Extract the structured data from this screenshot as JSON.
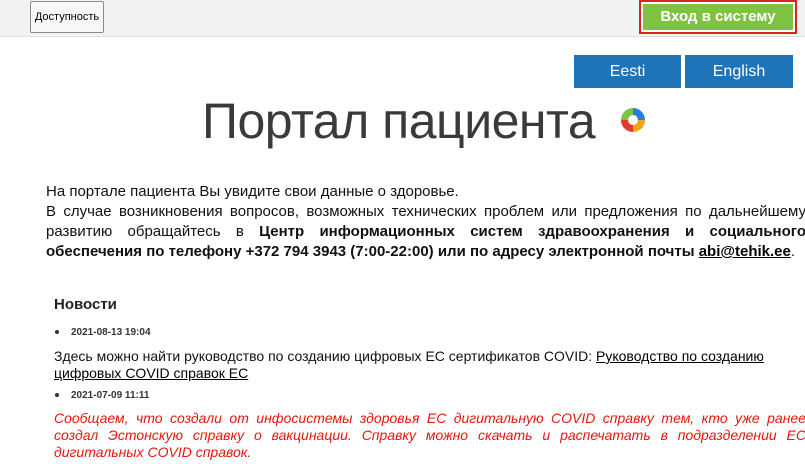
{
  "topbar": {
    "accessibility_label": "Доступность",
    "login_label": "Вход в систему"
  },
  "languages": [
    {
      "label": "Eesti"
    },
    {
      "label": "English"
    }
  ],
  "page": {
    "title": "Портал пациента"
  },
  "intro": {
    "line1": "На портале пациента Вы увидите свои данные о здоровье.",
    "line2_part1": "В случае возникновения вопросов, возможных технических проблем или предложения по дальнейшему развитию обращайтесь в ",
    "line2_bold": "Центр информационных систем здравоохранения и социального обеспечения по телефону +372 794 3943 (7:00-22:00) или по адресу электронной почты ",
    "email": "abi@tehik.ee",
    "line2_end": "."
  },
  "news": {
    "heading": "Новости",
    "items": [
      {
        "date": "2021-08-13 19:04",
        "text": "Здесь можно найти руководство по созданию цифровых ЕС сертификатов COVID: ",
        "link": "Руководство по созданию цифровых COVID справок ЕС"
      },
      {
        "date": "2021-07-09 11:11",
        "text": "Сообщаем, что создали от инфосистемы здоровья ЕС дигитальную COVID справку тем, кто уже ранее создал Эстонскую справку о вакцинации. Справку можно скачать и распечатать в подразделении ЕС дигитальных COVID справок."
      }
    ]
  },
  "colors": {
    "login_green": "#7dc241",
    "login_outline": "#d9251c",
    "language_blue": "#1f73b7",
    "news_red": "#e8160d"
  }
}
